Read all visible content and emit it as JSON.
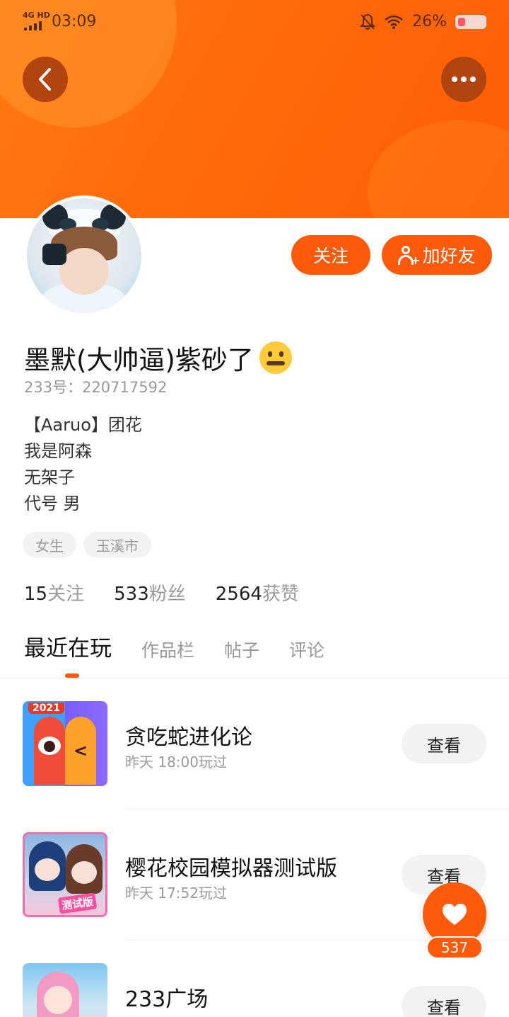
{
  "status_bar": {
    "network": "4G HD",
    "time": "03:09",
    "battery": "26%",
    "icons": [
      "bell-off-icon",
      "wifi-icon",
      "battery-icon"
    ]
  },
  "header": {
    "back_icon": "chevron-left-icon",
    "more_icon": "more-horizontal-icon",
    "accent_color": "#ff5a0a"
  },
  "profile": {
    "name": "墨默(大帅逼)紫砂了",
    "name_emoji": "zipper-mouth-face",
    "id_text": "233号：220717592",
    "bio_lines": [
      "【Aaruo】团花",
      "我是阿森",
      "无架子",
      "代号 男"
    ],
    "tags": [
      "女生",
      "玉溪市"
    ]
  },
  "actions": {
    "follow": "关注",
    "add_friend": "加好友"
  },
  "stats": [
    {
      "num": "15",
      "label": "关注"
    },
    {
      "num": "533",
      "label": "粉丝"
    },
    {
      "num": "2564",
      "label": "获赞"
    }
  ],
  "tabs": [
    "最近在玩",
    "作品栏",
    "帖子",
    "评论"
  ],
  "active_tab": 0,
  "games": [
    {
      "title": "贪吃蛇进化论",
      "sub": "昨天 18:00玩过",
      "button": "查看",
      "icon_badge": "2021"
    },
    {
      "title": "樱花校园模拟器测试版",
      "sub": "昨天 17:52玩过",
      "button": "查看",
      "icon_badge": "测试版"
    },
    {
      "title": "233广场",
      "sub": "",
      "button": "查看"
    }
  ],
  "like_fab": {
    "count": "537",
    "icon": "heart-icon"
  }
}
